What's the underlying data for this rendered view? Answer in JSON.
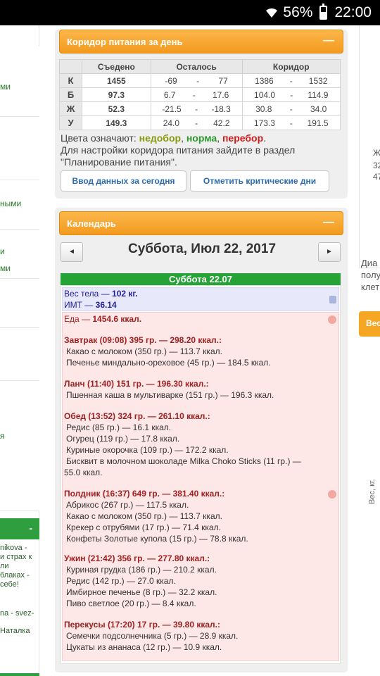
{
  "statusbar": {
    "battery": "56%",
    "time": "22:00"
  },
  "left_fragments": [
    "ми",
    "ными",
    "и",
    "ми",
    "я"
  ],
  "left_bar_label": "-",
  "left_notes": [
    "nikova -",
    "и страх к",
    "ли",
    "блаках -",
    "себе!",
    "na - svez-",
    "Наталка"
  ],
  "right_fragments": [
    "Ж",
    "32",
    "47",
    "Диа",
    "полу",
    "клет"
  ],
  "right_button_label": "Вес",
  "right_vertical_label": "Вес, кг.",
  "corridor": {
    "title": "Коридор питания за день",
    "minimize_icon": "minus",
    "headers": [
      "Съедено",
      "Осталось",
      "Коридор"
    ],
    "rows": [
      {
        "letter": "К",
        "eaten": "1455",
        "eaten_color": "#2a9a2a",
        "left_from": "-69",
        "left_to": "77",
        "corr_from": "1386",
        "corr_to": "1532"
      },
      {
        "letter": "Б",
        "eaten": "97.3",
        "eaten_color": "#8a9a10",
        "left_from": "6.7",
        "left_to": "17.6",
        "corr_from": "104.0",
        "corr_to": "114.9"
      },
      {
        "letter": "Ж",
        "eaten": "52.3",
        "eaten_color": "#d01b1b",
        "left_from": "-21.5",
        "left_to": "-18.3",
        "corr_from": "30.8",
        "corr_to": "34.0"
      },
      {
        "letter": "У",
        "eaten": "149.3",
        "eaten_color": "#8a9a10",
        "left_from": "24.0",
        "left_to": "42.2",
        "corr_from": "173.3",
        "corr_to": "191.5"
      }
    ],
    "range_dash": "-",
    "legend_prefix": "Цвета означают:",
    "legend_under": "недобор",
    "legend_norm": "норма",
    "legend_over": "перебор",
    "legend_colors": {
      "under": "#8a9a10",
      "norm": "#2a9a2a",
      "over": "#d01b1b"
    },
    "config_line1": "Для настройки коридора питания зайдите в раздел",
    "config_line2": "\"Планирование питания\".",
    "btn_input": "Ввод данных за сегодня",
    "btn_critical": "Отметить критические дни"
  },
  "calendar": {
    "title": "Календарь",
    "minimize_icon": "minus",
    "prev_icon": "◄",
    "next_icon": "►",
    "date": "Суббота, Июл 22, 2017",
    "day_header": "Суббота 22.07",
    "weight_label": "Вес тела —",
    "weight_value": "102 кг.",
    "bmi_label": "ИМТ —",
    "bmi_value": "36.14",
    "food_label": "Еда —",
    "food_value": "1454.6 ккал.",
    "meals": [
      {
        "header": "Завтрак (09:08) 395 гр. — 298.20 ккал.:",
        "items": [
          "Какао с молоком (350 гр.) — 113.7 ккал.",
          "Печенье миндально-ореховое (45 гр.) — 184.5 ккал."
        ]
      },
      {
        "header": "Ланч (11:40) 151 гр. — 196.30 ккал.:",
        "items": [
          "Пшенная каша в мультиварке (151 гр.) — 196.3 ккал."
        ]
      },
      {
        "header": "Обед (13:52) 324 гр. — 261.10 ккал.:",
        "items": [
          "Редис (85 гр.) — 16.1 ккал.",
          "Огурец (119 гр.) — 17.8 ккал.",
          "Куриные окорочка (109 гр.) — 172.2 ккал.",
          "Бисквит в молочном шоколаде Milka Choko Sticks (11 гр.) —",
          "55.0 ккал."
        ]
      },
      {
        "header": "Полдник (16:37) 649 гр. — 381.40 ккал.:",
        "items": [
          "Абрикос (267 гр.) — 117.5 ккал.",
          "Какао с молоком (350 гр.) — 113.7 ккал.",
          "Крекер с отрубями (17 гр.) — 71.4 ккал.",
          "Конфеты Золотые купола (15 гр.) — 78.8 ккал."
        ]
      },
      {
        "header": "Ужин (21:42) 356 гр. — 277.80 ккал.:",
        "items": [
          "Куриная грудка (186 гр.) — 210.2 ккал.",
          "Редис (142 гр.) — 27.0 ккал.",
          "Имбирное печенье (8 гр.) — 32.2 ккал.",
          "Пиво светлое (20 гр.) — 8.4 ккал."
        ]
      },
      {
        "header": "Перекусы (17:20) 17 гр. — 39.80 ккал.:",
        "items": [
          "Семечки подсолнечника (5 гр.) — 28.9 ккал.",
          "Цукаты из ананаса (12 гр.) — 10.9 ккал."
        ]
      }
    ]
  }
}
